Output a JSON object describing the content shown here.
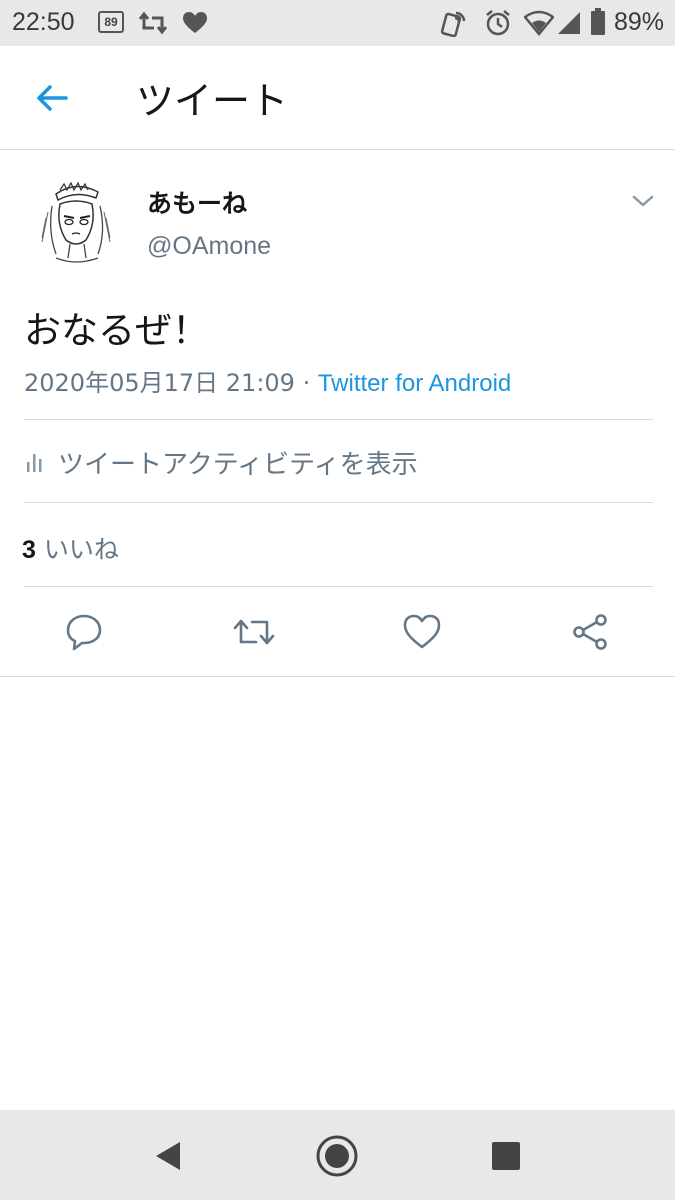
{
  "status_bar": {
    "time": "22:50",
    "badge": "89",
    "battery": "89%",
    "icons": [
      "notification-badge-icon",
      "retweet-notification-icon",
      "heart-notification-icon",
      "nfc-icon",
      "alarm-icon",
      "wifi-icon",
      "signal-icon",
      "battery-icon"
    ]
  },
  "header": {
    "title": "ツイート"
  },
  "tweet": {
    "display_name": "あもーね",
    "handle": "@OAmone",
    "text": "おなるぜ！",
    "timestamp": "2020年05月17日 21:09 · ",
    "source": "Twitter for Android",
    "activity_label": "ツイートアクティビティを表示",
    "likes_count": "3",
    "likes_label": " いいね"
  },
  "colors": {
    "accent": "#1b95e0",
    "text_primary": "#14171a",
    "text_secondary": "#657786",
    "divider": "#d6dde3",
    "system_bar": "#e8e8e8"
  }
}
